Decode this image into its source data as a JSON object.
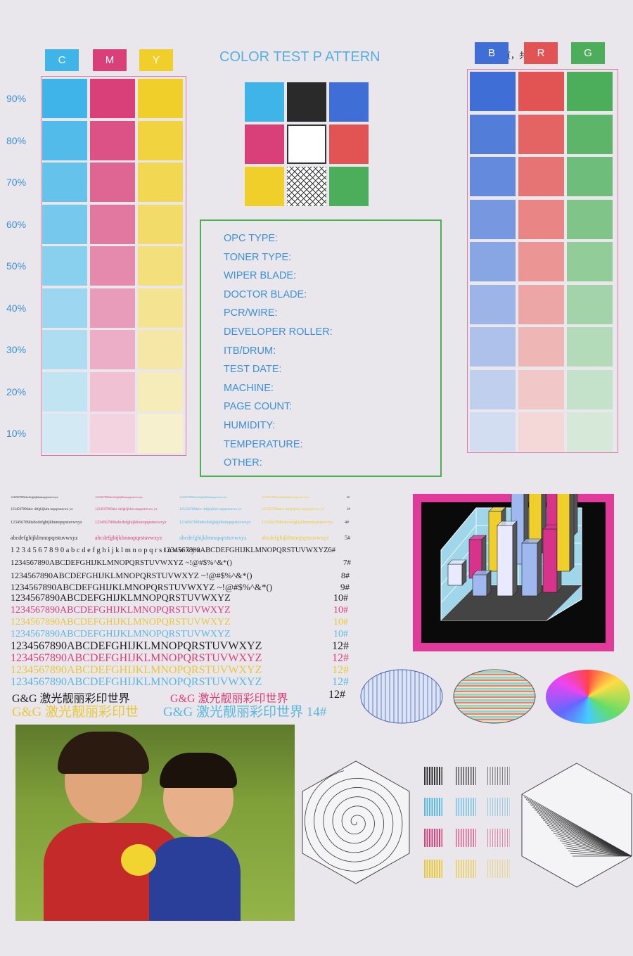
{
  "header": {
    "title": "COLOR TEST P    ATTERN",
    "page_number": "第 1 页，共 10 页"
  },
  "cmy": {
    "labels": [
      {
        "text": "C",
        "color": "#3fb4e8"
      },
      {
        "text": "M",
        "color": "#d9407a"
      },
      {
        "text": "Y",
        "color": "#f0cf2a"
      }
    ],
    "percentages": [
      "90%",
      "80%",
      "70%",
      "60%",
      "50%",
      "40%",
      "30%",
      "20%",
      "10%"
    ],
    "levels": [
      0.9,
      0.8,
      0.7,
      0.6,
      0.5,
      0.4,
      0.3,
      0.2,
      0.1
    ],
    "border_color": "#e07aa0"
  },
  "rgb": {
    "labels": [
      {
        "text": "B",
        "color": "#3f6fd6"
      },
      {
        "text": "R",
        "color": "#e25353"
      },
      {
        "text": "G",
        "color": "#4cae5a"
      }
    ],
    "levels": [
      0.9,
      0.8,
      0.7,
      0.6,
      0.5,
      0.4,
      0.3,
      0.2,
      0.1
    ],
    "border_color": "#e07aa0"
  },
  "center_grid": {
    "colors": [
      "#3fb4e8",
      "#2a2a2a",
      "#3f6fd6",
      "#d9407a",
      "#ffffff",
      "#e25353",
      "#f0cf2a",
      "pattern",
      "#4cae5a"
    ]
  },
  "form": {
    "fields": [
      "OPC TYPE:",
      "TONER TYPE:",
      "WIPER BLADE:",
      "DOCTOR BLADE:",
      "PCR/WIRE:",
      "DEVELOPER ROLLER:",
      "ITB/DRUM:",
      "TEST DATE:",
      "MACHINE:",
      "PAGE COUNT:",
      "HUMIDITY:",
      "TEMPERATURE:",
      "OTHER:"
    ]
  },
  "text_samples": [
    {
      "segments": [
        {
          "text": "1234567890abcdefghijklmnopqrstuvwxyz",
          "color": "#333"
        },
        {
          "text": "1234567890abcdefghijklmnopqrstuvwxyz",
          "color": "#d9407a"
        },
        {
          "text": "1234567890abcdefghijklmnopqrstuvwxyz",
          "color": "#5ab8e0"
        },
        {
          "text": "1234567890abcdefghijklmnopqrstuvwxyz",
          "color": "#e8c83a"
        },
        {
          "text": "2#",
          "color": "#333"
        }
      ]
    },
    {
      "segments": [
        {
          "text": "1234567890abc defghijklm nopqrstuvwx yz",
          "color": "#333"
        },
        {
          "text": "1234567890abc defghijklm nopqrstuvwx yz",
          "color": "#d9407a"
        },
        {
          "text": "1234567890abc defghijklm nopqrstuvwx yz",
          "color": "#5ab8e0"
        },
        {
          "text": "1234567890abc defghijklm nopqrstuvwx yz",
          "color": "#e8c83a"
        },
        {
          "text": "3#",
          "color": "#333"
        }
      ]
    },
    {
      "segments": [
        {
          "text": "1234567890abcdefghijklmnopqrstuvwxyz",
          "color": "#333"
        },
        {
          "text": "1234567890abcdefghijklmnopqrstuvwxyz",
          "color": "#d9407a"
        },
        {
          "text": "1234567890abcdefghijklmnopqrstuvwxyz",
          "color": "#5ab8e0"
        },
        {
          "text": "1234567890abcdefghijklmnopqrstuvwxyz",
          "color": "#e8c83a"
        },
        {
          "text": "4#",
          "color": "#333"
        }
      ]
    },
    {
      "segments": [
        {
          "text": "abcdefghijklmnopqrstuvwxyz",
          "color": "#333"
        },
        {
          "text": "abcdefghijklmnopqrstuvwxyz",
          "color": "#d9407a"
        },
        {
          "text": "abcdefghijklmnopqrstuvwxyz",
          "color": "#5ab8e0"
        },
        {
          "text": "abcdefghijklmnopqrstuvwxyz",
          "color": "#e8c83a"
        },
        {
          "text": "5#",
          "color": "#333"
        }
      ]
    },
    {
      "segments": [
        {
          "text": "1 2 3 4 5 6 7 8 9 0 a b c d e f g h i j k l m n o p q r s t u v w x y z",
          "color": "#222"
        },
        {
          "text": "1234567890ABCDEFGHIJKLMNOPQRSTUVWXYZ6#",
          "color": "#222"
        }
      ]
    },
    {
      "segments": [
        {
          "text": "1234567890ABCDEFGHIJKLMNOPQRSTUVWXYZ ~!@#$%^&*()",
          "color": "#222"
        },
        {
          "text": "7#",
          "color": "#222"
        }
      ]
    },
    {
      "segments": [
        {
          "text": "1234567890ABCDEFGHIJKLMNOPQRSTUVWXYZ ~!@#$%^&*()",
          "color": "#222"
        },
        {
          "text": "8#",
          "color": "#222"
        }
      ]
    },
    {
      "segments": [
        {
          "text": "1234567890ABCDEFGHIJKLMNOPQRSTUVWXYZ ~!@#$%^&*()",
          "color": "#222"
        },
        {
          "text": "9#",
          "color": "#222"
        }
      ]
    },
    {
      "segments": [
        {
          "text": "1234567890ABCDEFGHIJKLMNOPQRSTUVWXYZ",
          "color": "#222"
        },
        {
          "text": "10#",
          "color": "#222"
        }
      ]
    },
    {
      "segments": [
        {
          "text": "1234567890ABCDEFGHIJKLMNOPQRSTUVWXYZ",
          "color": "#d9407a"
        },
        {
          "text": "10#",
          "color": "#d9407a"
        }
      ]
    },
    {
      "segments": [
        {
          "text": "1234567890ABCDEFGHIJKLMNOPQRSTUVWXYZ",
          "color": "#e8c83a"
        },
        {
          "text": "10#",
          "color": "#e8c83a"
        }
      ]
    },
    {
      "segments": [
        {
          "text": "1234567890ABCDEFGHIJKLMNOPQRSTUVWXYZ",
          "color": "#5ab8e0"
        },
        {
          "text": "10#",
          "color": "#5ab8e0"
        }
      ]
    },
    {
      "segments": [
        {
          "text": "1234567890ABCDEFGHIJKLMNOPQRSTUVWXYZ",
          "color": "#222"
        },
        {
          "text": "12#",
          "color": "#222"
        }
      ]
    },
    {
      "segments": [
        {
          "text": "1234567890ABCDEFGHIJKLMNOPQRSTUVWXYZ",
          "color": "#d9407a"
        },
        {
          "text": "12#",
          "color": "#d9407a"
        }
      ]
    },
    {
      "segments": [
        {
          "text": "1234567890ABCDEFGHIJKLMNOPQRSTUVWXYZ",
          "color": "#e8c83a"
        },
        {
          "text": "12#",
          "color": "#e8c83a"
        }
      ]
    },
    {
      "segments": [
        {
          "text": "1234567890ABCDEFGHIJKLMNOPQRSTUVWXYZ",
          "color": "#5ab8e0"
        },
        {
          "text": "12#",
          "color": "#5ab8e0"
        }
      ]
    },
    {
      "segments": [
        {
          "text": "G&G 激光靓丽彩印世界",
          "color": "#222"
        },
        {
          "text": "G&G 激光靓丽彩印世界",
          "color": "#d9407a"
        },
        {
          "text": "12#",
          "color": "#222"
        }
      ]
    },
    {
      "segments": [
        {
          "text": "G&G 激光靓丽彩印世",
          "color": "#e8c83a"
        },
        {
          "text": "G&G 激光靓丽彩印世界 14#",
          "color": "#5ab8e0"
        }
      ]
    }
  ],
  "graphics": {
    "chart_frame_color": "#e03a9a",
    "stripe_colors": [
      "#333333",
      "#5ab8e0",
      "#d9407a",
      "#e8c83a"
    ]
  }
}
